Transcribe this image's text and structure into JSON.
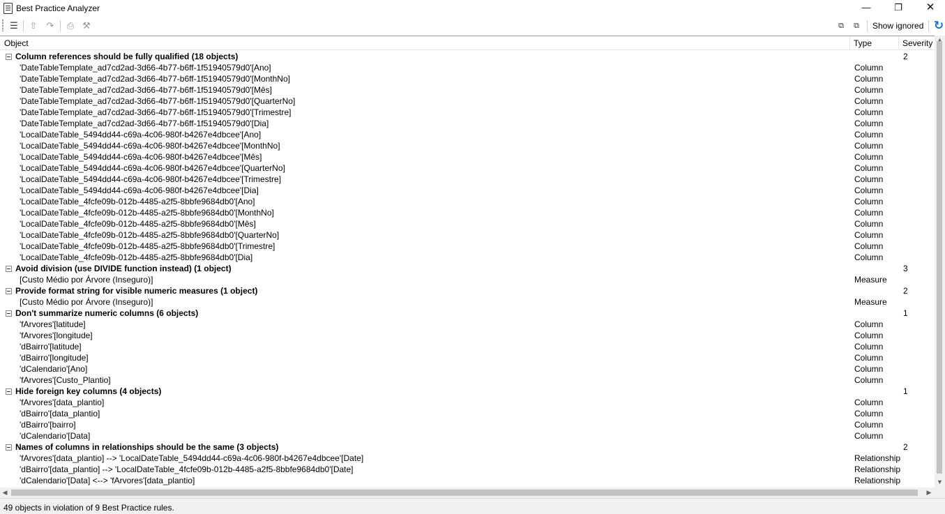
{
  "window": {
    "title": "Best Practice Analyzer",
    "icon": "clipboard-icon"
  },
  "toolbar": {
    "show_ignored_label": "Show ignored"
  },
  "columns": {
    "object": "Object",
    "type": "Type",
    "severity": "Severity"
  },
  "groups": [
    {
      "title": "Column references should be fully qualified (18 objects)",
      "severity": "2",
      "items": [
        {
          "object": "'DateTableTemplate_ad7cd2ad-3d66-4b77-b6ff-1f51940579d0'[Ano]",
          "type": "Column"
        },
        {
          "object": "'DateTableTemplate_ad7cd2ad-3d66-4b77-b6ff-1f51940579d0'[MonthNo]",
          "type": "Column"
        },
        {
          "object": "'DateTableTemplate_ad7cd2ad-3d66-4b77-b6ff-1f51940579d0'[Mês]",
          "type": "Column"
        },
        {
          "object": "'DateTableTemplate_ad7cd2ad-3d66-4b77-b6ff-1f51940579d0'[QuarterNo]",
          "type": "Column"
        },
        {
          "object": "'DateTableTemplate_ad7cd2ad-3d66-4b77-b6ff-1f51940579d0'[Trimestre]",
          "type": "Column"
        },
        {
          "object": "'DateTableTemplate_ad7cd2ad-3d66-4b77-b6ff-1f51940579d0'[Dia]",
          "type": "Column"
        },
        {
          "object": "'LocalDateTable_5494dd44-c69a-4c06-980f-b4267e4dbcee'[Ano]",
          "type": "Column"
        },
        {
          "object": "'LocalDateTable_5494dd44-c69a-4c06-980f-b4267e4dbcee'[MonthNo]",
          "type": "Column"
        },
        {
          "object": "'LocalDateTable_5494dd44-c69a-4c06-980f-b4267e4dbcee'[Mês]",
          "type": "Column"
        },
        {
          "object": "'LocalDateTable_5494dd44-c69a-4c06-980f-b4267e4dbcee'[QuarterNo]",
          "type": "Column"
        },
        {
          "object": "'LocalDateTable_5494dd44-c69a-4c06-980f-b4267e4dbcee'[Trimestre]",
          "type": "Column"
        },
        {
          "object": "'LocalDateTable_5494dd44-c69a-4c06-980f-b4267e4dbcee'[Dia]",
          "type": "Column"
        },
        {
          "object": "'LocalDateTable_4fcfe09b-012b-4485-a2f5-8bbfe9684db0'[Ano]",
          "type": "Column"
        },
        {
          "object": "'LocalDateTable_4fcfe09b-012b-4485-a2f5-8bbfe9684db0'[MonthNo]",
          "type": "Column"
        },
        {
          "object": "'LocalDateTable_4fcfe09b-012b-4485-a2f5-8bbfe9684db0'[Mês]",
          "type": "Column"
        },
        {
          "object": "'LocalDateTable_4fcfe09b-012b-4485-a2f5-8bbfe9684db0'[QuarterNo]",
          "type": "Column"
        },
        {
          "object": "'LocalDateTable_4fcfe09b-012b-4485-a2f5-8bbfe9684db0'[Trimestre]",
          "type": "Column"
        },
        {
          "object": "'LocalDateTable_4fcfe09b-012b-4485-a2f5-8bbfe9684db0'[Dia]",
          "type": "Column"
        }
      ]
    },
    {
      "title": "Avoid division (use DIVIDE function instead) (1 object)",
      "severity": "3",
      "items": [
        {
          "object": "[Custo Médio por Árvore (Inseguro)]",
          "type": "Measure"
        }
      ]
    },
    {
      "title": "Provide format string for visible numeric measures (1 object)",
      "severity": "2",
      "items": [
        {
          "object": "[Custo Médio por Árvore (Inseguro)]",
          "type": "Measure"
        }
      ]
    },
    {
      "title": "Don't summarize numeric columns (6 objects)",
      "severity": "1",
      "items": [
        {
          "object": "'fArvores'[latitude]",
          "type": "Column"
        },
        {
          "object": "'fArvores'[longitude]",
          "type": "Column"
        },
        {
          "object": "'dBairro'[latitude]",
          "type": "Column"
        },
        {
          "object": "'dBairro'[longitude]",
          "type": "Column"
        },
        {
          "object": "'dCalendario'[Ano]",
          "type": "Column"
        },
        {
          "object": "'fArvores'[Custo_Plantio]",
          "type": "Column"
        }
      ]
    },
    {
      "title": "Hide foreign key columns (4 objects)",
      "severity": "1",
      "items": [
        {
          "object": "'fArvores'[data_plantio]",
          "type": "Column"
        },
        {
          "object": "'dBairro'[data_plantio]",
          "type": "Column"
        },
        {
          "object": "'dBairro'[bairro]",
          "type": "Column"
        },
        {
          "object": "'dCalendario'[Data]",
          "type": "Column"
        }
      ]
    },
    {
      "title": "Names of columns in relationships should be the same (3 objects)",
      "severity": "2",
      "items": [
        {
          "object": "'fArvores'[data_plantio] --> 'LocalDateTable_5494dd44-c69a-4c06-980f-b4267e4dbcee'[Date]",
          "type": "Relationship"
        },
        {
          "object": "'dBairro'[data_plantio] --> 'LocalDateTable_4fcfe09b-012b-4485-a2f5-8bbfe9684db0'[Date]",
          "type": "Relationship"
        },
        {
          "object": "'dCalendario'[Data] <--> 'fArvores'[data_plantio]",
          "type": "Relationship"
        }
      ]
    }
  ],
  "status": {
    "text": "49 objects in violation of 9 Best Practice rules."
  }
}
